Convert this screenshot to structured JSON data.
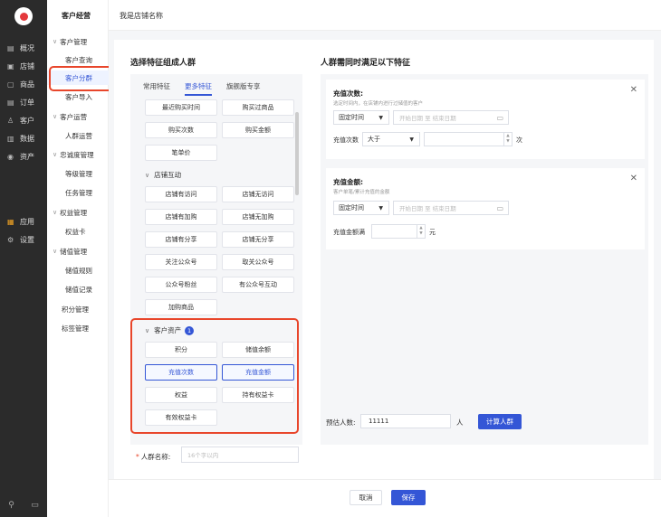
{
  "nav_dark": {
    "items": [
      {
        "icon": "▤",
        "label": "概况"
      },
      {
        "icon": "▣",
        "label": "店铺"
      },
      {
        "icon": "▢",
        "label": "商品"
      },
      {
        "icon": "▤",
        "label": "订单"
      },
      {
        "icon": "♙",
        "label": "客户"
      },
      {
        "icon": "▥",
        "label": "数据"
      },
      {
        "icon": "◉",
        "label": "资产"
      },
      {
        "icon": "▦",
        "label": "应用"
      },
      {
        "icon": "⚙",
        "label": "设置"
      }
    ],
    "bottom": [
      "⚲",
      "▭"
    ]
  },
  "subnav": {
    "header": "客户经营",
    "items": [
      {
        "label": "客户管理",
        "group": true
      },
      {
        "label": "客户查询"
      },
      {
        "label": "客户分群",
        "active": true
      },
      {
        "label": "客户导入"
      },
      {
        "label": "客户运营",
        "group": true
      },
      {
        "label": "人群运营"
      },
      {
        "label": "忠诚度管理",
        "group": true
      },
      {
        "label": "等级管理"
      },
      {
        "label": "任务管理"
      },
      {
        "label": "权益管理",
        "group": true
      },
      {
        "label": "权益卡"
      },
      {
        "label": "储值管理",
        "group": true
      },
      {
        "label": "储值规则"
      },
      {
        "label": "储值记录"
      },
      {
        "label": "积分管理"
      },
      {
        "label": "标签管理"
      }
    ]
  },
  "topbar": {
    "title": "我是店铺名称"
  },
  "left_section": {
    "title": "选择特征组成人群",
    "tabs": [
      "常用特征",
      "更多特征",
      "旗舰版专享"
    ],
    "top_chips": [
      "最近购买时间",
      "购买过商品",
      "购买次数",
      "购买金额",
      "笔单价"
    ],
    "group_store": "店铺互动",
    "store_chips": [
      "店铺有访问",
      "店铺无访问",
      "店铺有加购",
      "店铺无加购",
      "店铺有分享",
      "店铺无分享",
      "关注公众号",
      "取关公众号",
      "公众号粉丝",
      "有公众号互动",
      "加购商品"
    ],
    "group_assets": "客户资产",
    "assets_badge": "1",
    "asset_chips": [
      "积分",
      "储值余额",
      "充值次数",
      "充值金额",
      "权益",
      "持有权益卡",
      "有效权益卡"
    ]
  },
  "right_section": {
    "title": "人群需同时满足以下特征",
    "cond1": {
      "title": "充值次数:",
      "desc": "选定时间内，在店铺内进行过储值的客户",
      "time_type": "固定时间",
      "start_ph": "开始日期",
      "sep": "至",
      "end_ph": "结束日期",
      "label": "充值次数",
      "op": "大于",
      "unit": "次"
    },
    "cond2": {
      "title": "充值金额:",
      "desc": "客户单笔/累计充值的金额",
      "time_type": "固定时间",
      "start_ph": "开始日期",
      "sep": "至",
      "end_ph": "结束日期",
      "label": "充值金额满",
      "unit": "元"
    },
    "estimate_label": "预估人数:",
    "estimate_value": "11111",
    "estimate_unit": "人",
    "calc_button": "计算人群"
  },
  "name_field": {
    "label": "人群名称:",
    "required": "*",
    "placeholder": "16个字以内"
  },
  "footer": {
    "cancel": "取消",
    "save": "保存"
  }
}
